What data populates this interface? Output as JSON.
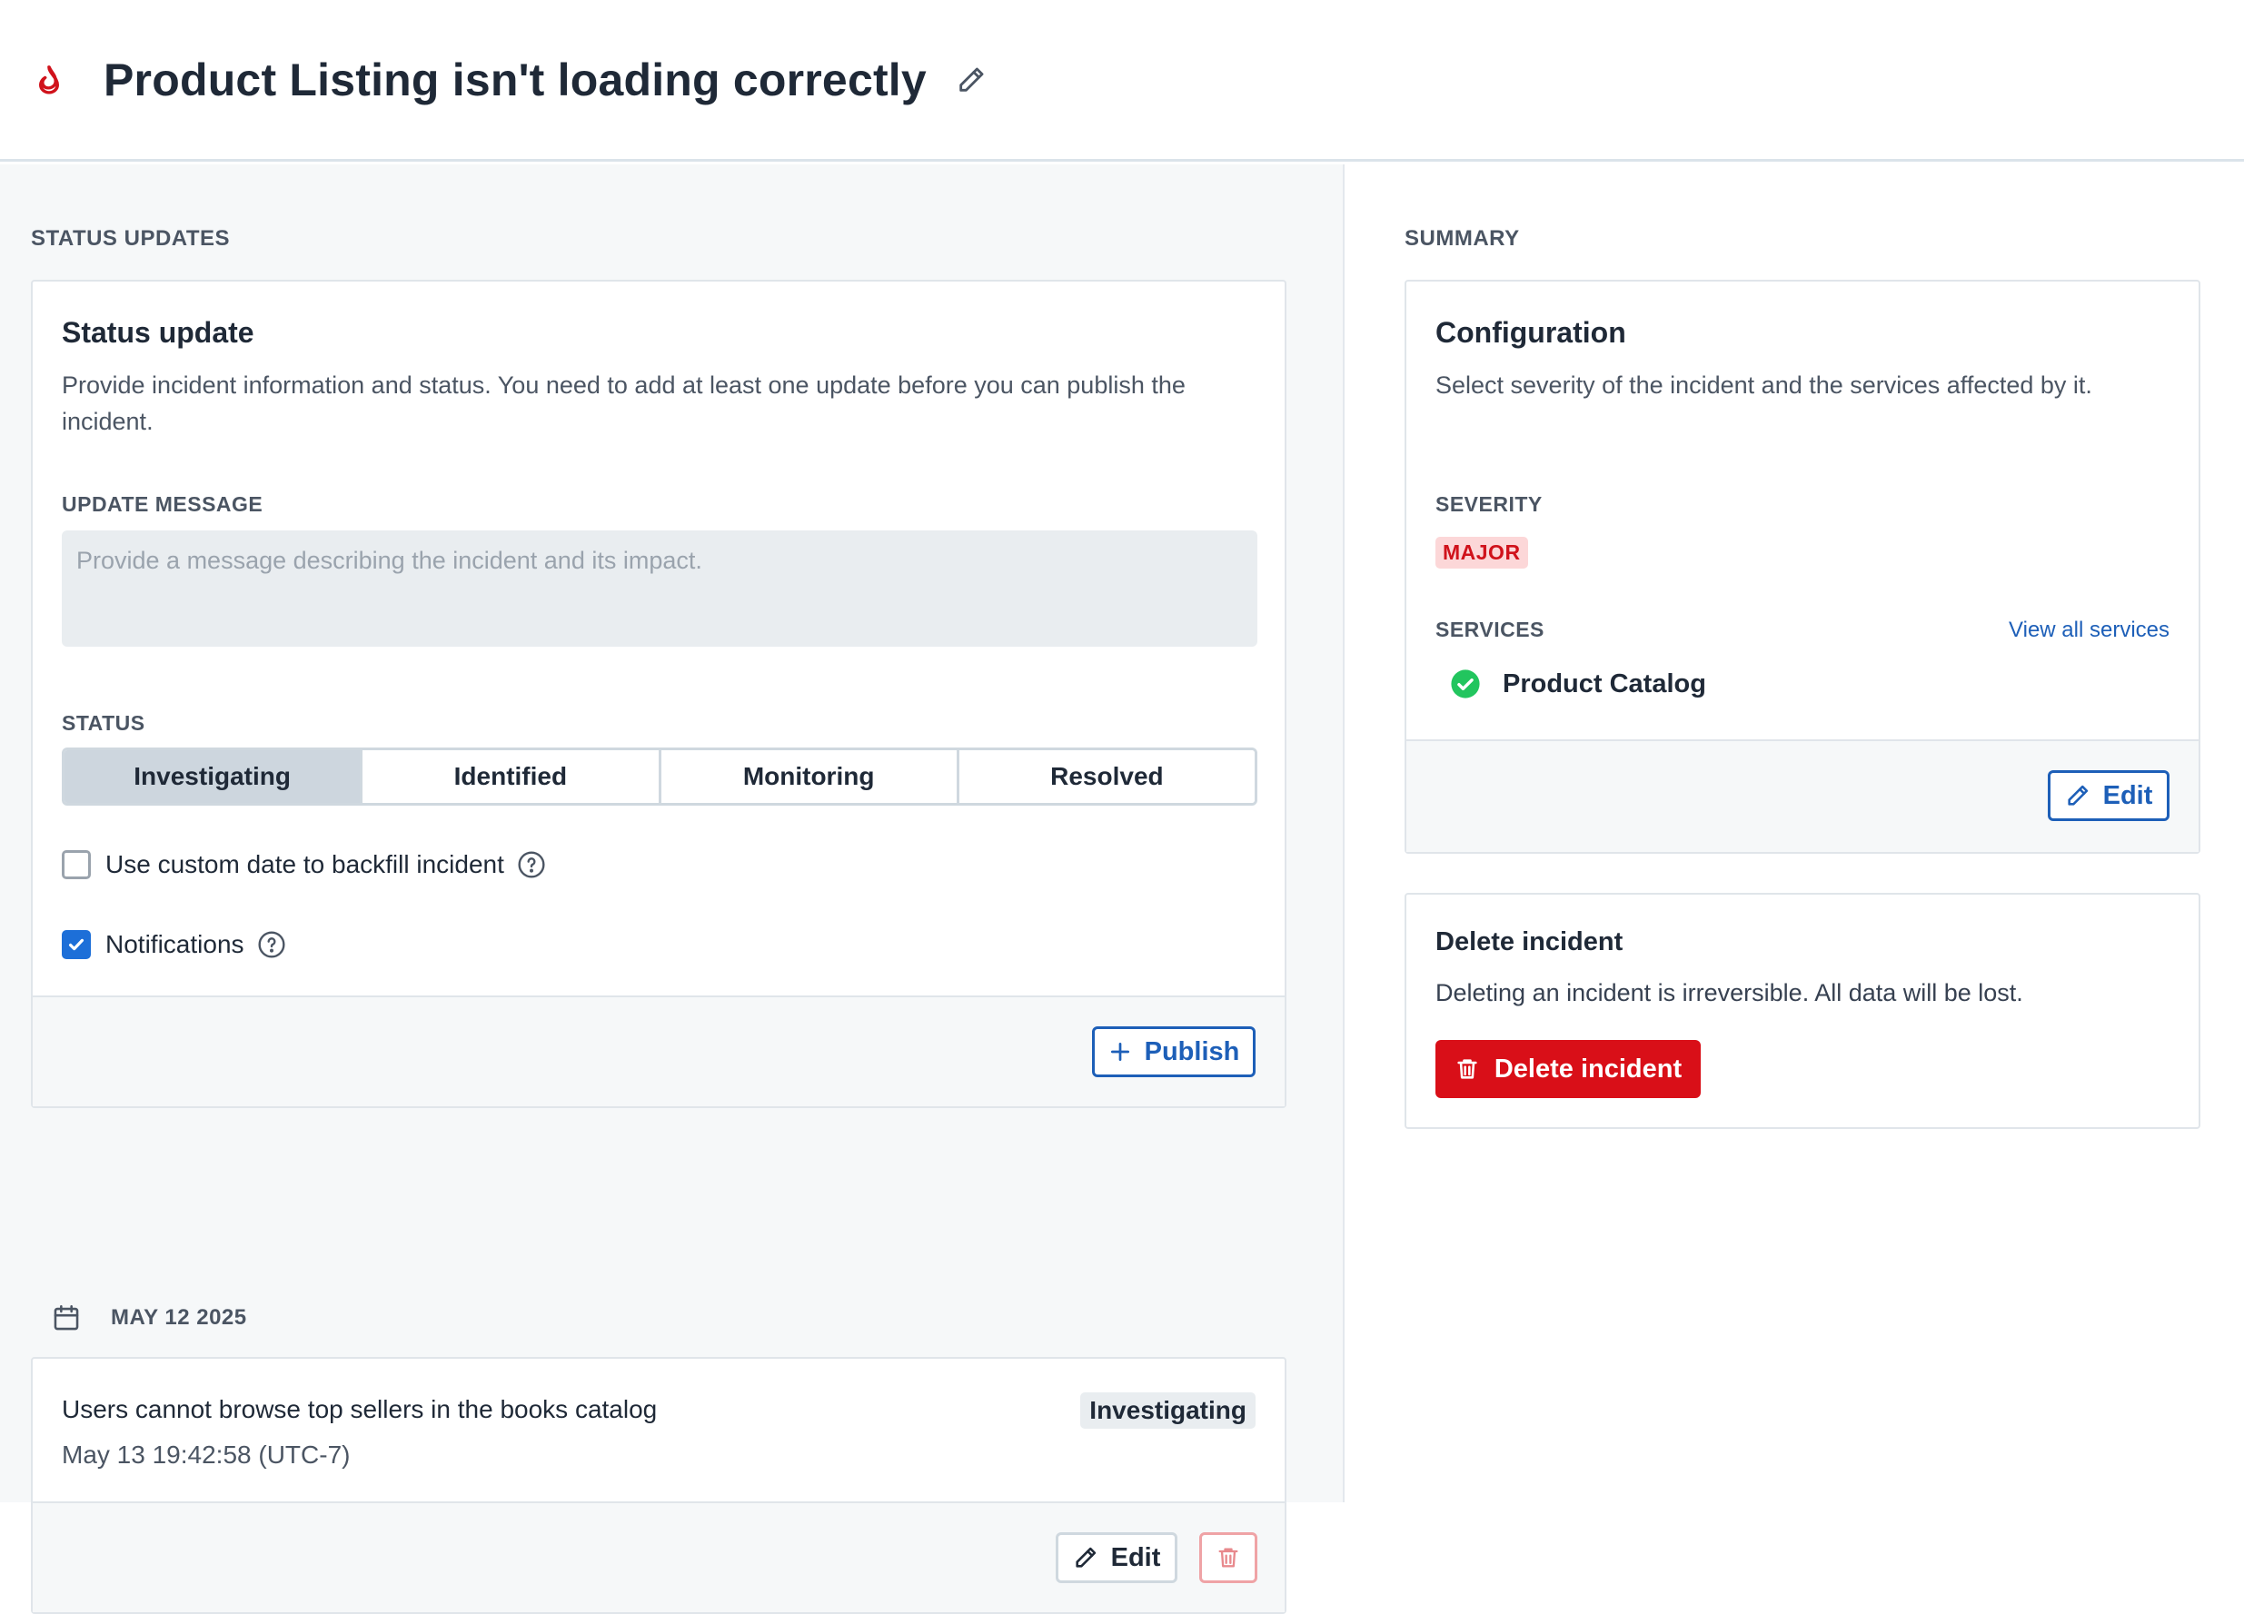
{
  "header": {
    "title": "Product Listing isn't loading correctly",
    "icon": "flame-icon",
    "edit_icon": "pencil-icon"
  },
  "status_updates": {
    "section_label": "STATUS UPDATES",
    "card": {
      "title": "Status update",
      "description": "Provide incident information and status. You need to add at least one update before you can publish the incident.",
      "message_label": "UPDATE MESSAGE",
      "message_value": "",
      "message_placeholder": "Provide a message describing the incident and its impact.",
      "status_label": "STATUS",
      "status_options": [
        "Investigating",
        "Identified",
        "Monitoring",
        "Resolved"
      ],
      "status_selected": "Investigating",
      "custom_date_label": "Use custom date to backfill incident",
      "custom_date_checked": false,
      "notifications_label": "Notifications",
      "notifications_checked": true,
      "publish_label": "Publish"
    },
    "date_group": "MAY 12 2025",
    "updates": [
      {
        "message": "Users cannot browse top sellers in the books catalog",
        "timestamp": "May 13 19:42:58 (UTC-7)",
        "status": "Investigating",
        "edit_label": "Edit"
      }
    ]
  },
  "summary": {
    "section_label": "SUMMARY",
    "configuration": {
      "title": "Configuration",
      "description": "Select severity of the incident and the services affected by it.",
      "severity_label": "SEVERITY",
      "severity_value": "MAJOR",
      "services_label": "SERVICES",
      "view_all_label": "View all services",
      "services": [
        {
          "name": "Product Catalog",
          "status": "operational"
        }
      ],
      "edit_label": "Edit"
    },
    "delete": {
      "title": "Delete incident",
      "description": "Deleting an incident is irreversible. All data will be lost.",
      "button_label": "Delete incident"
    }
  },
  "colors": {
    "accent_blue": "#1d5fb8",
    "danger_red": "#d90f18",
    "success_green": "#22c55e",
    "severity_bg": "#fcd7d8"
  }
}
